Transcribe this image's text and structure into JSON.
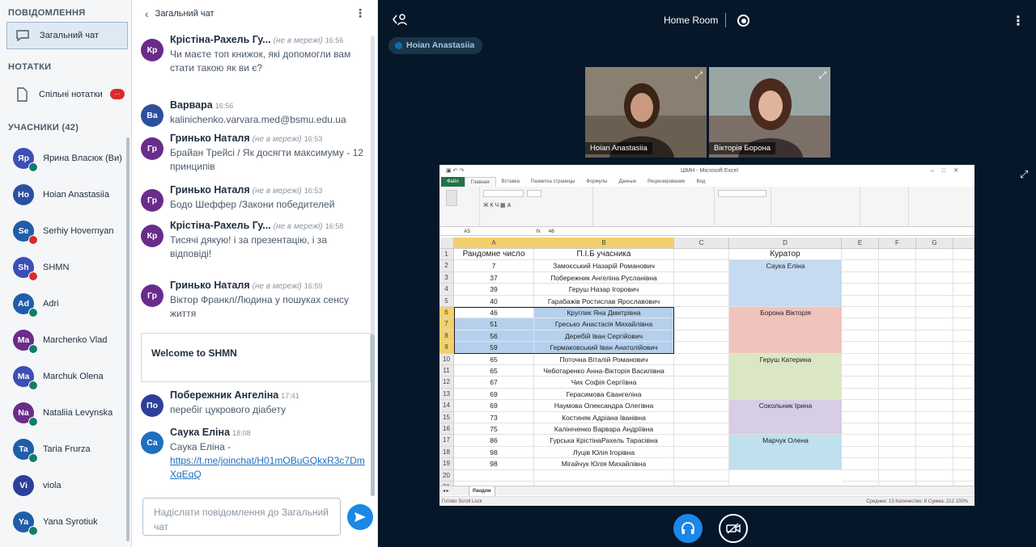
{
  "sidebar": {
    "messages_title": "ПОВІДОМЛЕННЯ",
    "public_chat": "Загальний чат",
    "notes_title": "НОТАТКИ",
    "shared_notes": "Спільні нотатки",
    "shared_notes_badge": "···",
    "users_title": "УЧАСНИКИ (42)",
    "users": [
      {
        "initials": "Яр",
        "name": "Ярина Власюк (Ви)",
        "color": "#3b4fb5",
        "mic": "green"
      },
      {
        "initials": "Ho",
        "name": "Hoian Anastasiia",
        "color": "#2d4fa0",
        "mic": "none"
      },
      {
        "initials": "Se",
        "name": "Serhiy Hovernyan",
        "color": "#1f5ea8",
        "mic": "red"
      },
      {
        "initials": "Sh",
        "name": "SHMN",
        "color": "#3b4fb5",
        "mic": "red"
      },
      {
        "initials": "Ad",
        "name": "Adri",
        "color": "#1f5ea8",
        "mic": "green"
      },
      {
        "initials": "Ma",
        "name": "Marchenko Vlad",
        "color": "#6a2c8a",
        "mic": "green"
      },
      {
        "initials": "Ma",
        "name": "Marchuk Olena",
        "color": "#3b4fb5",
        "mic": "green"
      },
      {
        "initials": "Na",
        "name": "Nataliia Levynska",
        "color": "#6a2c8a",
        "mic": "green"
      },
      {
        "initials": "Ta",
        "name": "Taria Frurza",
        "color": "#1f5ea8",
        "mic": "green"
      },
      {
        "initials": "Vi",
        "name": "viola",
        "color": "#2d3f9a",
        "mic": "none"
      },
      {
        "initials": "Ya",
        "name": "Yana Syrotiuk",
        "color": "#1f5ea8",
        "mic": "green"
      }
    ]
  },
  "chat": {
    "title": "Загальний чат",
    "messages": [
      {
        "initials": "Кр",
        "color": "#6a2c8a",
        "author": "Крістіна-Рахель Гу...",
        "status": "(не в мережі)",
        "time": "16:56",
        "text": "Чи маєте топ книжок, які допомогли вам стати такою як ви є?",
        "link": ""
      },
      {
        "initials": "Ва",
        "color": "#2d4fa0",
        "author": "Варвара",
        "status": "",
        "time": "16:56",
        "text": "kalinichenko.varvara.med@bsmu.edu.ua",
        "link": ""
      },
      {
        "initials": "Гр",
        "color": "#6a2c8a",
        "author": "Гринько Наталя",
        "status": "(не в мережі)",
        "time": "16:53",
        "text": "Брайан Трейсі / Як досягти максимуму - 12 принципів",
        "link": ""
      },
      {
        "initials": "Гр",
        "color": "#6a2c8a",
        "author": "Гринько Наталя",
        "status": "(не в мережі)",
        "time": "16:53",
        "text": "Бодо Шеффер /Закони победителей",
        "link": ""
      },
      {
        "initials": "Кр",
        "color": "#6a2c8a",
        "author": "Крістіна-Рахель Гу...",
        "status": "(не в мережі)",
        "time": "16:58",
        "text": "Тисячі дякую! і за презентацію, і за відповіді!",
        "link": ""
      },
      {
        "initials": "Гр",
        "color": "#6a2c8a",
        "author": "Гринько Наталя",
        "status": "(не в мережі)",
        "time": "16:59",
        "text": "Віктор Франкл/Людина у пошуках сенсу життя",
        "link": ""
      },
      {
        "initials": "По",
        "color": "#2d3f9a",
        "author": "Побережник Ангеліна",
        "status": "",
        "time": "17:41",
        "text": "перебіг цукрового діабету",
        "link": ""
      },
      {
        "initials": "Са",
        "color": "#1f6fbf",
        "author": "Саука Еліна",
        "status": "",
        "time": "18:08",
        "text": "Саука Еліна -",
        "link": "https://t.me/joinchat/H01mOBuGQkxR3c7DmXqEqQ"
      }
    ],
    "welcome": "Welcome to SHMN",
    "input_placeholder": "Надіслати повідомлення до Загальний чат"
  },
  "room": {
    "title": "Home Room",
    "talker": "Hoian Anastasiia",
    "tiles": [
      {
        "name": "Hoian Anastasiia"
      },
      {
        "name": "Вікторія Борона"
      }
    ]
  },
  "spreadsheet": {
    "window_title": "ШМН - Microsoft Excel",
    "ribbon_tabs": [
      "Файл",
      "Главная",
      "Вставка",
      "Разметка страницы",
      "Формулы",
      "Данные",
      "Рецензирование",
      "Вид"
    ],
    "cell_ref": "A5",
    "formula": "46",
    "columns": [
      "A",
      "B",
      "C",
      "D",
      "E",
      "F",
      "G"
    ],
    "header_row": {
      "a": "Рандомне число",
      "b": "П.І.Б учасника",
      "d": "Куратор"
    },
    "rows": [
      {
        "n": "2",
        "a": "7",
        "b": "Замоєський Назарій Романович"
      },
      {
        "n": "3",
        "a": "37",
        "b": "Побережник Ангеліна Русланівна"
      },
      {
        "n": "4",
        "a": "39",
        "b": "Геруш Назар Ігорович"
      },
      {
        "n": "5",
        "a": "40",
        "b": "Гарабажів Ростислав Ярославович"
      },
      {
        "n": "6",
        "a": "46",
        "b": "Круглик Яна Дмитрівна"
      },
      {
        "n": "7",
        "a": "51",
        "b": "Гресько Анастасія Михайлівна"
      },
      {
        "n": "8",
        "a": "56",
        "b": "Деребій Іван Сергійович"
      },
      {
        "n": "9",
        "a": "59",
        "b": "Гермаковський Іван Анатолійович"
      },
      {
        "n": "10",
        "a": "65",
        "b": "Поточна Віталій Романович"
      },
      {
        "n": "11",
        "a": "65",
        "b": "Чеботаренко Анна-Вікторія Василівна"
      },
      {
        "n": "12",
        "a": "67",
        "b": "Чих Софія Сергіївна"
      },
      {
        "n": "13",
        "a": "69",
        "b": "Герасимова Євангеліна"
      },
      {
        "n": "14",
        "a": "69",
        "b": "Наумова Олександра Олегівна"
      },
      {
        "n": "15",
        "a": "73",
        "b": "Костиняк Адріана Іванівна"
      },
      {
        "n": "16",
        "a": "75",
        "b": "Калініченко Варвара Андріївна"
      },
      {
        "n": "17",
        "a": "86",
        "b": "Гурська КрістінаРахель Тарасівна"
      },
      {
        "n": "18",
        "a": "98",
        "b": "Луців Юлія Ігорівна"
      },
      {
        "n": "19",
        "a": "98",
        "b": "Мігайчук Юлія Михайлівна"
      },
      {
        "n": "20",
        "a": "",
        "b": ""
      },
      {
        "n": "21",
        "a": "",
        "b": ""
      }
    ],
    "curators": [
      {
        "name": "Саука Еліна",
        "color": "#c6daf1"
      },
      {
        "name": "Борона Вікторія",
        "color": "#f1c3bd"
      },
      {
        "name": "Геруш Катерина",
        "color": "#dbe7c4"
      },
      {
        "name": "Сокольник Ірина",
        "color": "#d7cde6"
      },
      {
        "name": "Марчук Олена",
        "color": "#bfe0ee"
      }
    ],
    "sheet_tab": "Рандом",
    "status_left": "Готово   Scroll Lock",
    "status_right": "Среднее: 13   Количество: 8   Сумма: 212      100%"
  }
}
